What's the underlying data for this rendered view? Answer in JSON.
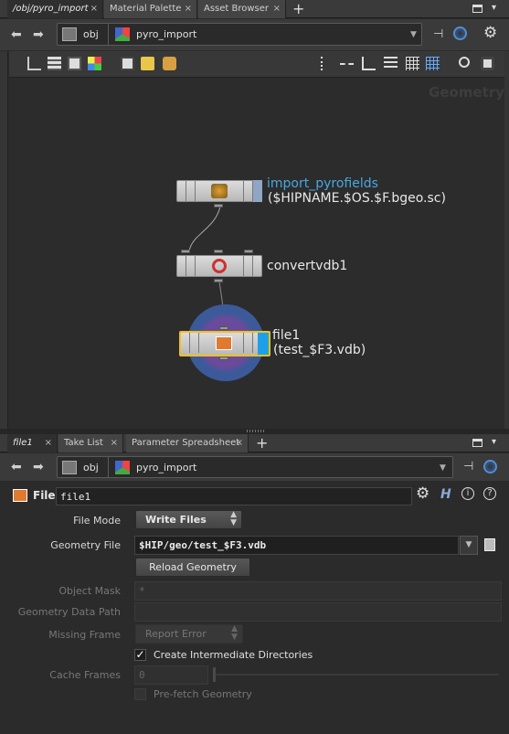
{
  "top_tabs": [
    {
      "label": "/obj/pyro_import",
      "active": true
    },
    {
      "label": "Material Palette",
      "active": false
    },
    {
      "label": "Asset Browser",
      "active": false
    }
  ],
  "top_path": {
    "root": "obj",
    "current": "pyro_import"
  },
  "network": {
    "watermark": "Geometry",
    "nodes": [
      {
        "name": "import_pyrofields",
        "sublabel": "($HIPNAME.$OS.$F.bgeo.sc)"
      },
      {
        "name": "convertvdb1",
        "sublabel": ""
      },
      {
        "name": "file1",
        "sublabel": "(test_$F3.vdb)"
      }
    ]
  },
  "bottom_tabs": [
    {
      "label": "file1",
      "active": true
    },
    {
      "label": "Take List",
      "active": false
    },
    {
      "label": "Parameter Spreadsheet",
      "active": false
    }
  ],
  "bottom_path": {
    "root": "obj",
    "current": "pyro_import"
  },
  "param_header": {
    "type_label": "File",
    "node_name": "file1"
  },
  "params": {
    "file_mode": {
      "label": "File Mode",
      "value": "Write Files"
    },
    "geometry_file": {
      "label": "Geometry File",
      "value": "$HIP/geo/test_$F3.vdb"
    },
    "reload_button": "Reload Geometry",
    "object_mask": {
      "label": "Object Mask",
      "value": "*"
    },
    "geometry_data_path": {
      "label": "Geometry Data Path",
      "value": ""
    },
    "missing_frame": {
      "label": "Missing Frame",
      "value": "Report Error"
    },
    "create_dirs": {
      "label": "Create Intermediate Directories",
      "checked": true
    },
    "cache_frames": {
      "label": "Cache Frames",
      "value": "0"
    },
    "prefetch": {
      "label": "Pre-fetch Geometry",
      "checked": false
    }
  },
  "colors": {
    "accent": "#49a7e0",
    "selected_node": "#f0c020",
    "node_ring": "#3c5a9a"
  }
}
